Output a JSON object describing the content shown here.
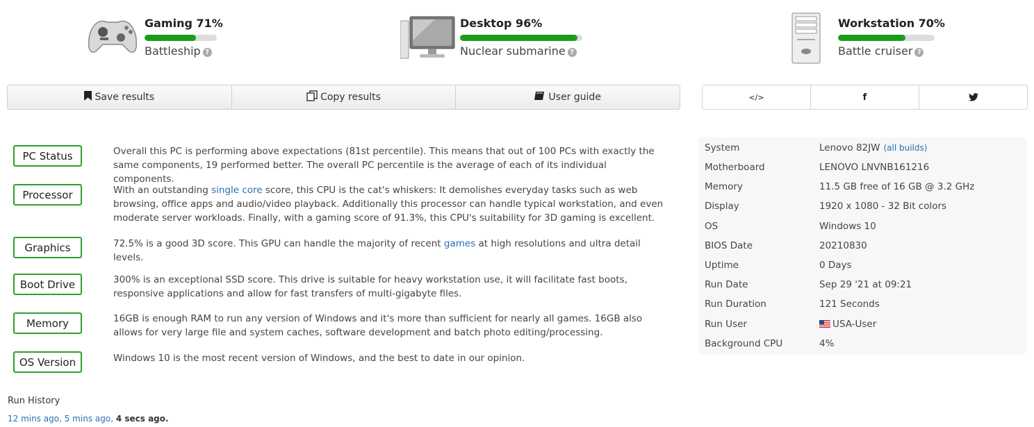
{
  "usage": [
    {
      "title": "Gaming 71%",
      "subtitle": "Battleship",
      "percent": 71,
      "icon": "gamepad-icon"
    },
    {
      "title": "Desktop 96%",
      "subtitle": "Nuclear submarine",
      "percent": 96,
      "icon": "monitor-icon"
    },
    {
      "title": "Workstation 70%",
      "subtitle": "Battle cruiser",
      "percent": 70,
      "icon": "tower-icon"
    }
  ],
  "toolbar": {
    "save": "Save results",
    "copy": "Copy results",
    "guide": "User guide"
  },
  "share": {
    "embed": "</>",
    "facebook": "f",
    "twitter": "🐦"
  },
  "summary": [
    {
      "label": "PC Status",
      "text": "Overall this PC is performing above expectations (81st percentile). This means that out of 100 PCs with exactly the same components, 19 performed better. The overall PC percentile is the average of each of its individual components."
    },
    {
      "label": "Processor",
      "pre": "With an outstanding ",
      "link": "single core",
      "post": " score, this CPU is the cat's whiskers: It demolishes everyday tasks such as web browsing, office apps and audio/video playback. Additionally this processor can handle typical workstation, and even moderate server workloads. Finally, with a gaming score of 91.3%, this CPU's suitability for 3D gaming is excellent."
    },
    {
      "label": "Graphics",
      "pre": "72.5% is a good 3D score. This GPU can handle the majority of recent ",
      "link": "games",
      "post": " at high resolutions and ultra detail levels."
    },
    {
      "label": "Boot Drive",
      "text": "300% is an exceptional SSD score. This drive is suitable for heavy workstation use, it will facilitate fast boots, responsive applications and allow for fast transfers of multi-gigabyte files."
    },
    {
      "label": "Memory",
      "text": "16GB is enough RAM to run any version of Windows and it's more than sufficient for nearly all games. 16GB also allows for very large file and system caches, software development and batch photo editing/processing."
    },
    {
      "label": "OS Version",
      "text": "Windows 10 is the most recent version of Windows, and the best to date in our opinion."
    }
  ],
  "specs": [
    {
      "key": "System",
      "value": "Lenovo 82JW",
      "extra": "(all builds)"
    },
    {
      "key": "Motherboard",
      "value": "LENOVO LNVNB161216"
    },
    {
      "key": "Memory",
      "value": "11.5 GB free of 16 GB @ 3.2 GHz"
    },
    {
      "key": "Display",
      "value": "1920 x 1080 - 32 Bit colors"
    },
    {
      "key": "OS",
      "value": "Windows 10"
    },
    {
      "key": "BIOS Date",
      "value": "20210830"
    },
    {
      "key": "Uptime",
      "value": "0 Days"
    },
    {
      "key": "Run Date",
      "value": "Sep 29 '21 at 09:21"
    },
    {
      "key": "Run Duration",
      "value": "121 Seconds"
    },
    {
      "key": "Run User",
      "value": "USA-User"
    },
    {
      "key": "Background CPU",
      "value": "4%"
    }
  ],
  "history": {
    "title": "Run History",
    "links": [
      "12 mins ago",
      "5 mins ago"
    ],
    "current": "4 secs ago."
  }
}
